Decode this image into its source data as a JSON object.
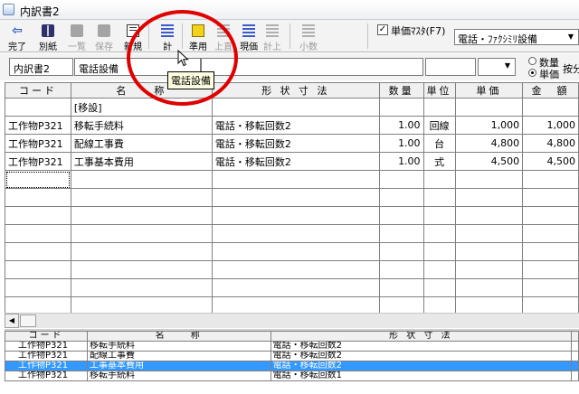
{
  "window": {
    "title": "内訳書2"
  },
  "toolbar": {
    "buttons": [
      {
        "label": "完了",
        "icon": "back-arrow-icon",
        "enabled": true
      },
      {
        "label": "別紙",
        "icon": "book-icon",
        "enabled": true
      },
      {
        "label": "一覧",
        "icon": "book-icon",
        "enabled": false
      },
      {
        "label": "保存",
        "icon": "book-icon",
        "enabled": false
      },
      {
        "label": "新規",
        "icon": "document-icon",
        "enabled": true
      },
      {
        "label": "計",
        "icon": "lines-icon",
        "enabled": true
      },
      {
        "label": "準用",
        "icon": "yellow-square-icon",
        "enabled": true
      },
      {
        "label": "上直",
        "icon": "lines-icon",
        "enabled": false
      },
      {
        "label": "現価",
        "icon": "lines-icon",
        "enabled": true
      },
      {
        "label": "計上",
        "icon": "lines-icon",
        "enabled": false
      },
      {
        "label": "小数",
        "icon": "lines-icon",
        "enabled": false
      }
    ],
    "checkbox": {
      "label": "単価ﾏｽﾀ(F7)",
      "checked": true
    },
    "master_select": {
      "value": "電話・ﾌｧｸｼﾐﾘ設備"
    }
  },
  "info": {
    "doc_name": "内訳書2",
    "item_name": "電話設備",
    "radio": [
      {
        "label": "数量",
        "checked": false
      },
      {
        "label": "単価",
        "checked": true
      }
    ],
    "extra_label": "按分"
  },
  "tooltip": {
    "text": "電話設備"
  },
  "main_table": {
    "columns": [
      "コード",
      "名　　称",
      "形 状 寸 法",
      "数量",
      "単位",
      "単価",
      "金　額"
    ],
    "rows": [
      [
        "",
        "[移設]",
        "",
        "",
        "",
        "",
        ""
      ],
      [
        "工作物P321",
        "移転手続料",
        "電話・移転回数2",
        "1.00",
        "回線",
        "1,000",
        "1,000"
      ],
      [
        "工作物P321",
        "配線工事費",
        "電話・移転回数2",
        "1.00",
        "台",
        "4,800",
        "4,800"
      ],
      [
        "工作物P321",
        "工事基本費用",
        "電話・移転回数2",
        "1.00",
        "式",
        "4,500",
        "4,500"
      ],
      [
        "",
        "",
        "",
        "",
        "",
        "",
        ""
      ],
      [
        "",
        "",
        "",
        "",
        "",
        "",
        ""
      ],
      [
        "",
        "",
        "",
        "",
        "",
        "",
        ""
      ],
      [
        "",
        "",
        "",
        "",
        "",
        "",
        ""
      ],
      [
        "",
        "",
        "",
        "",
        "",
        "",
        ""
      ],
      [
        "",
        "",
        "",
        "",
        "",
        "",
        ""
      ],
      [
        "",
        "",
        "",
        "",
        "",
        "",
        ""
      ],
      [
        "",
        "",
        "",
        "",
        "",
        "",
        ""
      ]
    ]
  },
  "lookup_table": {
    "columns": [
      "コード",
      "名　　称",
      "形 状 寸 法",
      ""
    ],
    "rows": [
      [
        "工作物P321",
        "移転手続料",
        "電話・移転回数2",
        ""
      ],
      [
        "工作物P321",
        "配線工事費",
        "電話・移転回数2",
        ""
      ],
      [
        "工作物P321",
        "工事基本費用",
        "電話・移転回数2",
        ""
      ],
      [
        "工作物P321",
        "移転手続料",
        "電話・移転回数1",
        ""
      ]
    ],
    "selected_row": 2
  },
  "colors": {
    "selection": "#3399ff",
    "annotation_circle": "#e00000",
    "tooltip_bg": "#ffffe1"
  }
}
